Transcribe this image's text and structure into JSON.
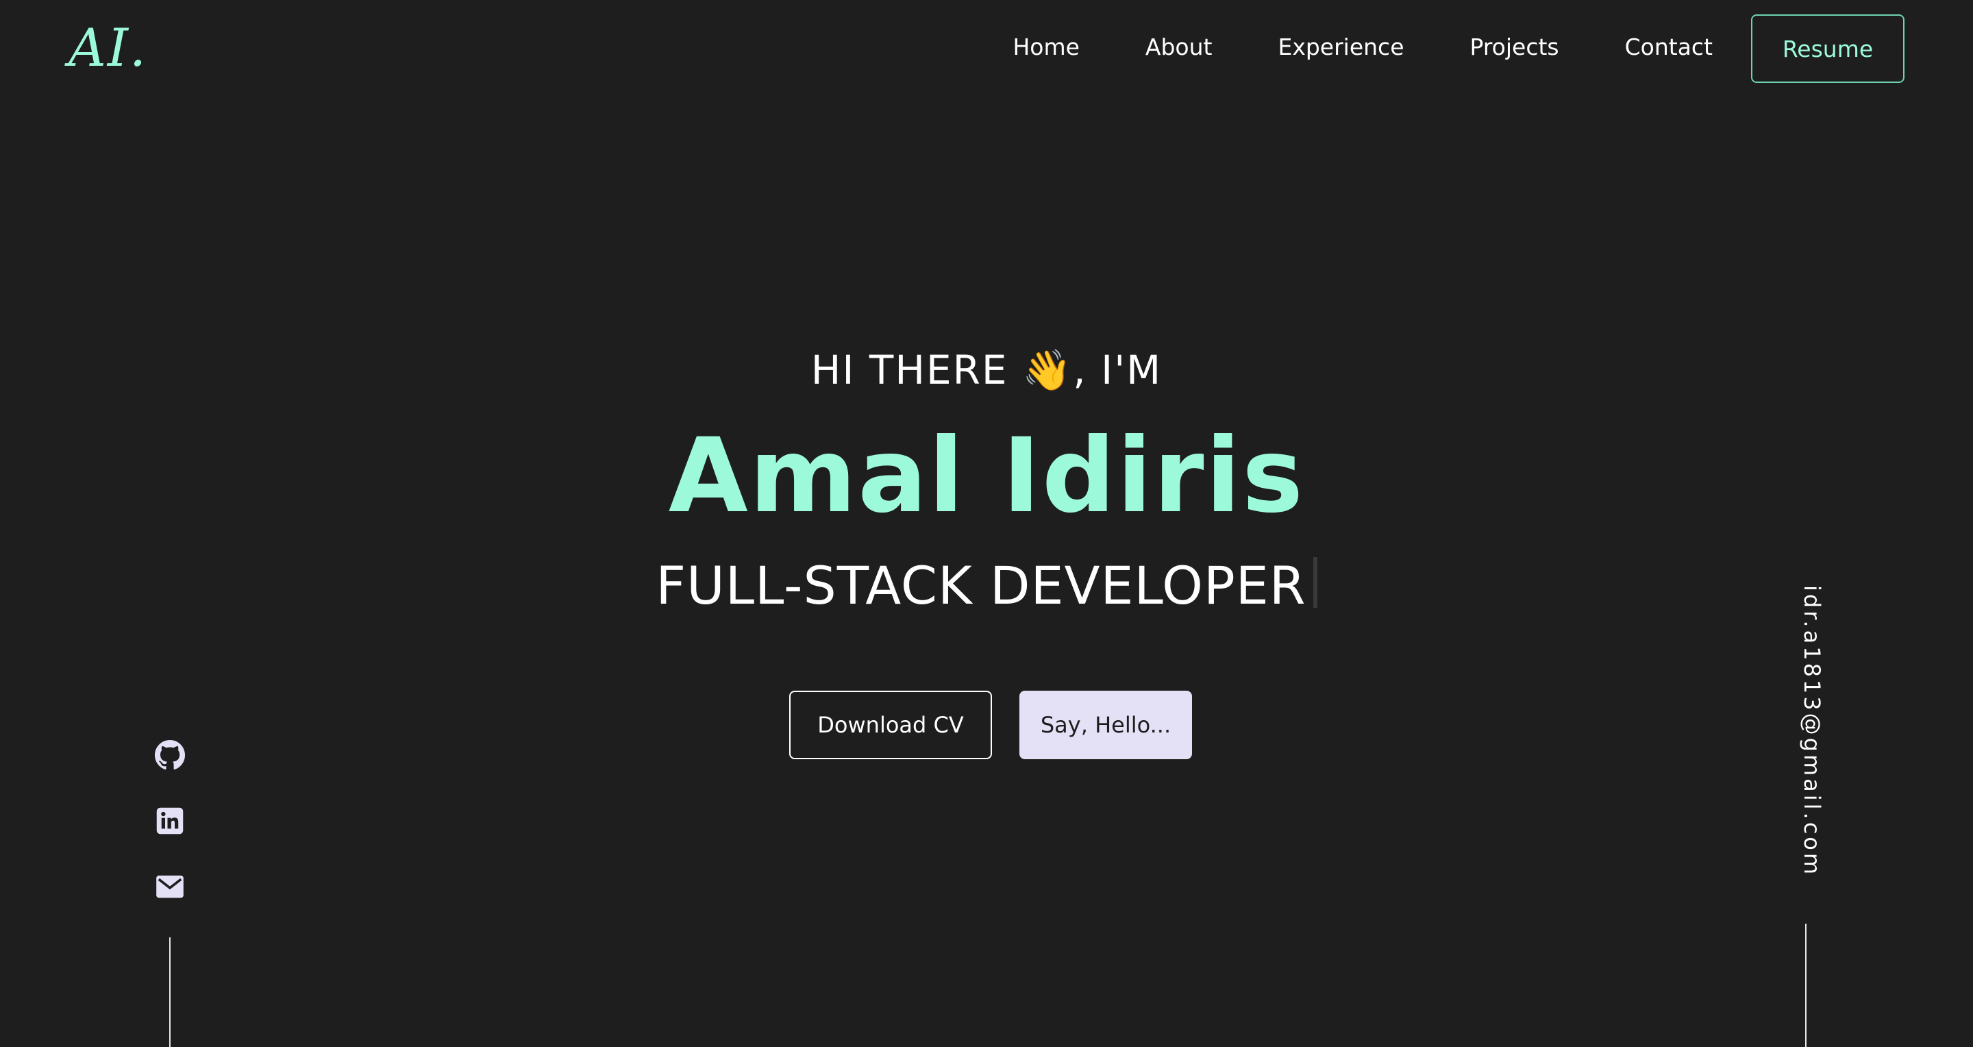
{
  "header": {
    "logo": "AI.",
    "nav": [
      "Home",
      "About",
      "Experience",
      "Projects",
      "Contact"
    ],
    "resume_label": "Resume"
  },
  "hero": {
    "greeting_prefix": "HI THERE",
    "greeting_emoji": "👋",
    "greeting_suffix": ", I'M",
    "name": "Amal Idiris",
    "role": "FULL-STACK DEVELOPER",
    "download_label": "Download CV",
    "hello_label": "Say, Hello..."
  },
  "socials": {
    "icons": [
      "github-icon",
      "linkedin-icon",
      "mail-icon"
    ]
  },
  "email": "idr.a1813@gmail.com",
  "colors": {
    "background": "#1e1e1e",
    "accent": "#9cfadb",
    "hello_button": "#e4e1f7"
  }
}
